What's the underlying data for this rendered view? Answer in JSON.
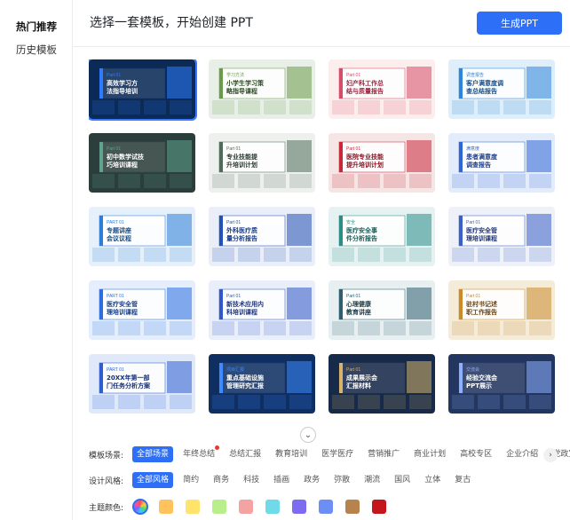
{
  "sidebar": {
    "items": [
      {
        "label": "热门推荐",
        "active": true
      },
      {
        "label": "历史模板",
        "active": false
      }
    ]
  },
  "header": {
    "title": "选择一套模板，开始创建 PPT",
    "generate_label": "生成PPT"
  },
  "templates": [
    {
      "title": "高效学习方法指导培训",
      "sub": "Part 01",
      "bg": "#0b2a55",
      "accent": "#2f7bff",
      "text": "#ffffff",
      "selected": true
    },
    {
      "title": "小学生学习策略指导课程",
      "sub": "学习方法",
      "bg": "#e8efe6",
      "accent": "#6c9a4c",
      "text": "#2c4a1f",
      "selected": false
    },
    {
      "title": "妇产科工作总结与质量报告",
      "sub": "Part 01",
      "bg": "#fdeeee",
      "accent": "#d64c6a",
      "text": "#9b2540",
      "selected": false
    },
    {
      "title": "客户满意度调查总结报告",
      "sub": "调查报告",
      "bg": "#dfeefb",
      "accent": "#2f86d8",
      "text": "#1b4e86",
      "selected": false
    },
    {
      "title": "初中数学试技巧培训课程",
      "sub": "Part 01",
      "bg": "#2c3e3b",
      "accent": "#5fa38e",
      "text": "#ffffff",
      "selected": false
    },
    {
      "title": "专业技能提升培训计划",
      "sub": "Part 01",
      "bg": "#eef0ee",
      "accent": "#4f6b5a",
      "text": "#2a3a30",
      "selected": false
    },
    {
      "title": "医院专业技能提升培训计划",
      "sub": "Part 01",
      "bg": "#f6e5e5",
      "accent": "#c8283a",
      "text": "#8e1222",
      "selected": false
    },
    {
      "title": "患者满意度调查报告",
      "sub": "满意度",
      "bg": "#e3ecfb",
      "accent": "#2f66d6",
      "text": "#1c3f8c",
      "selected": false
    },
    {
      "title": "专题讲座会议议程",
      "sub": "PART 01",
      "bg": "#e6f0fb",
      "accent": "#2c7fd8",
      "text": "#174a87",
      "selected": false
    },
    {
      "title": "外科医疗质量分析报告",
      "sub": "Part 01",
      "bg": "#e9eef8",
      "accent": "#2451b5",
      "text": "#1b3b86",
      "selected": false
    },
    {
      "title": "医疗安全事件分析报告",
      "sub": "安全",
      "bg": "#e5f2f1",
      "accent": "#2a8e88",
      "text": "#175c58",
      "selected": false
    },
    {
      "title": "医疗安全管理培训课程",
      "sub": "Part 01",
      "bg": "#eef1f8",
      "accent": "#3a5fc8",
      "text": "#22367a",
      "selected": false
    },
    {
      "title": "医疗安全管理培训课程",
      "sub": "PART 01",
      "bg": "#e4eefc",
      "accent": "#2c6fe0",
      "text": "#173f86",
      "selected": false
    },
    {
      "title": "新技术应用内科培训课程",
      "sub": "Part 01",
      "bg": "#e9eefb",
      "accent": "#3257c6",
      "text": "#1d3582",
      "selected": false
    },
    {
      "title": "心理健康教育讲座",
      "sub": "Part 01",
      "bg": "#e7eff1",
      "accent": "#2e5f6e",
      "text": "#1c3c46",
      "selected": false
    },
    {
      "title": "驻村书记述职工作报告",
      "sub": "Part 01",
      "bg": "#f5ebd9",
      "accent": "#c98a2a",
      "text": "#6b4414",
      "selected": false
    },
    {
      "title": "20XX年第一部门任务分析方案",
      "sub": "PART 01",
      "bg": "#dfe9fa",
      "accent": "#2d5fd0",
      "text": "#142f78",
      "selected": false
    },
    {
      "title": "重点基础设施管理研究汇报",
      "sub": "项目汇报",
      "bg": "#0f2f63",
      "accent": "#3d8bff",
      "text": "#ffffff",
      "selected": false
    },
    {
      "title": "成果展示会汇报材料",
      "sub": "Part 01",
      "bg": "#172a4a",
      "accent": "#d7b46a",
      "text": "#ffffff",
      "selected": false
    },
    {
      "title": "经验交流会PPT展示",
      "sub": "交流会",
      "bg": "#23365f",
      "accent": "#8fb0ff",
      "text": "#ffffff",
      "selected": false
    }
  ],
  "filters": {
    "scene": {
      "label": "模板场景:",
      "options": [
        {
          "label": "全部场景",
          "active": true,
          "dot": false
        },
        {
          "label": "年终总结",
          "active": false,
          "dot": true
        },
        {
          "label": "总结汇报",
          "active": false,
          "dot": false
        },
        {
          "label": "教育培训",
          "active": false,
          "dot": false
        },
        {
          "label": "医学医疗",
          "active": false,
          "dot": false
        },
        {
          "label": "营销推广",
          "active": false,
          "dot": false
        },
        {
          "label": "商业计划",
          "active": false,
          "dot": false
        },
        {
          "label": "高校专区",
          "active": false,
          "dot": false
        },
        {
          "label": "企业介绍",
          "active": false,
          "dot": false
        },
        {
          "label": "党政宣传",
          "active": false,
          "dot": false
        }
      ]
    },
    "style": {
      "label": "设计风格:",
      "options": [
        {
          "label": "全部风格",
          "active": true
        },
        {
          "label": "简约",
          "active": false
        },
        {
          "label": "商务",
          "active": false
        },
        {
          "label": "科技",
          "active": false
        },
        {
          "label": "插画",
          "active": false
        },
        {
          "label": "政务",
          "active": false
        },
        {
          "label": "弥散",
          "active": false
        },
        {
          "label": "潮流",
          "active": false
        },
        {
          "label": "国风",
          "active": false
        },
        {
          "label": "立体",
          "active": false
        },
        {
          "label": "复古",
          "active": false
        }
      ]
    },
    "color": {
      "label": "主题颜色:",
      "swatches": [
        "#ffc25c",
        "#ffe36a",
        "#b8ef8c",
        "#f4a3a3",
        "#6fdbe8",
        "#7d6cf2",
        "#6c8ef5",
        "#b8824f",
        "#c4161c"
      ]
    }
  },
  "icons": {
    "collapse": "chevron-down-icon",
    "scroll_right": "chevron-right-icon",
    "all_colors": "rainbow-wheel-icon"
  }
}
